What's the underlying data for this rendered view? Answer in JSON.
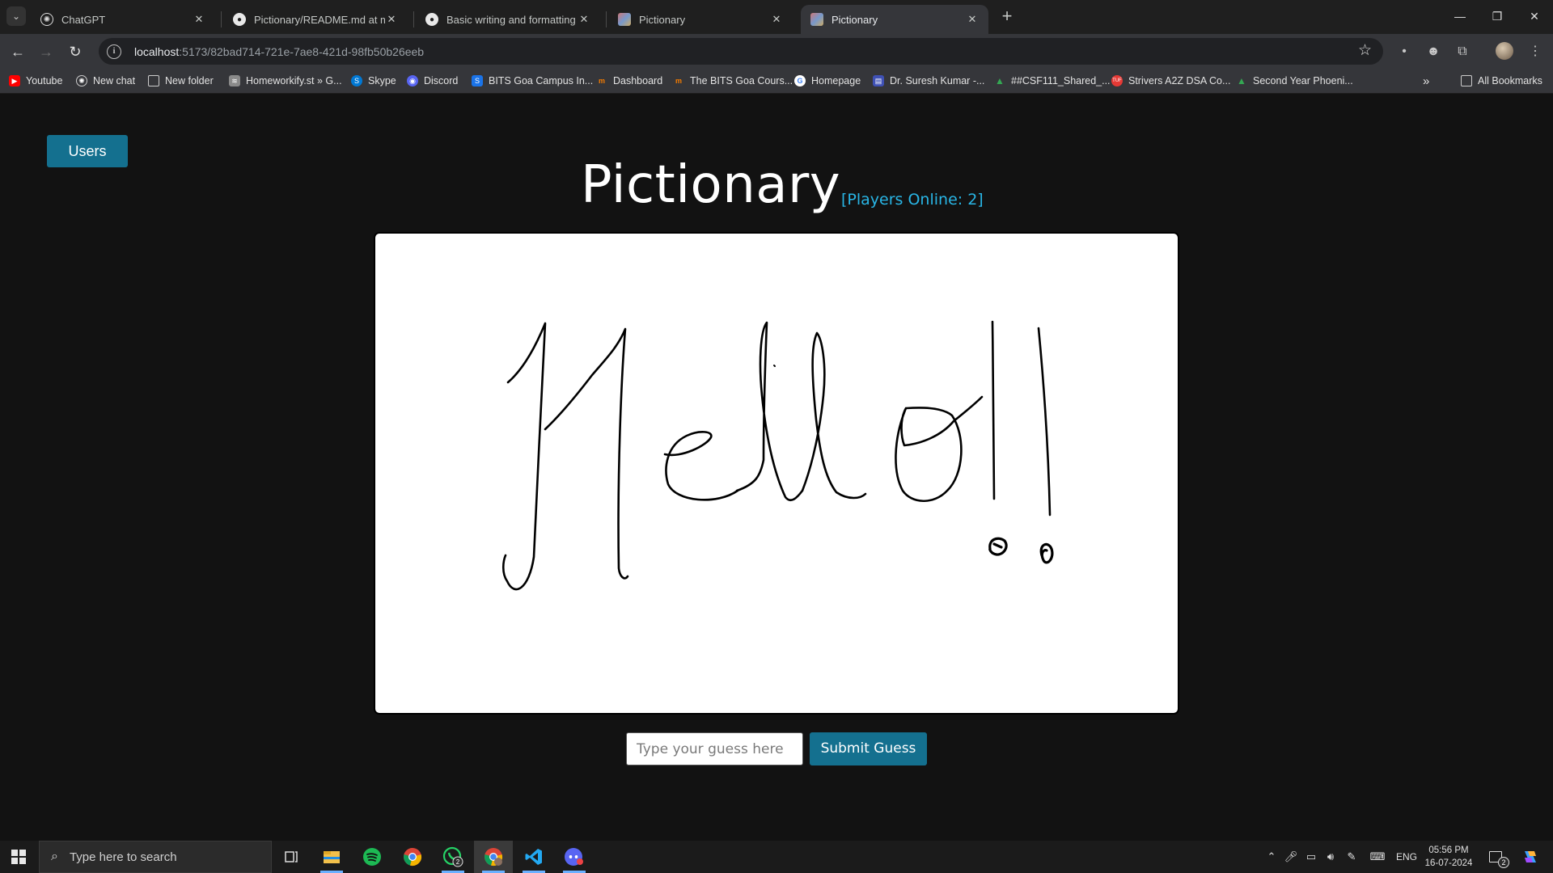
{
  "browser": {
    "tabs": [
      {
        "title": "ChatGPT",
        "icon": "chatgpt-icon"
      },
      {
        "title": "Pictionary/README.md at main",
        "icon": "github-icon"
      },
      {
        "title": "Basic writing and formatting sy",
        "icon": "github-docs-icon"
      },
      {
        "title": "Pictionary",
        "icon": "pictionary-favicon"
      },
      {
        "title": "Pictionary",
        "icon": "pictionary-favicon"
      }
    ],
    "active_tab": 4,
    "url_host": "localhost",
    "url_path": ":5173/82bad714-721e-7ae8-421d-98fb50b26eeb",
    "bookmarks": [
      {
        "label": "Youtube",
        "color": "#ff0000"
      },
      {
        "label": "New chat",
        "color": "#7a7a7a"
      },
      {
        "label": "New folder",
        "color": "#35363a"
      },
      {
        "label": "Homeworkify.st » G...",
        "color": "#8a8a8a"
      },
      {
        "label": "Skype",
        "color": "#0078d4"
      },
      {
        "label": "Discord",
        "color": "#5865f2"
      },
      {
        "label": "BITS Goa Campus In...",
        "color": "#1a73e8"
      },
      {
        "label": "Dashboard",
        "color": "#f57c00"
      },
      {
        "label": "The BITS Goa Cours...",
        "color": "#f57c00"
      },
      {
        "label": "Homepage",
        "color": "#ffffff"
      },
      {
        "label": "Dr. Suresh Kumar -...",
        "color": "#3f51b5"
      },
      {
        "label": "##CSF111_Shared_...",
        "color": "#34a853"
      },
      {
        "label": "Strivers A2Z DSA Co...",
        "color": "#e53935"
      },
      {
        "label": "Second Year Phoeni...",
        "color": "#34a853"
      }
    ],
    "all_bookmarks": "All Bookmarks"
  },
  "page": {
    "users_button": "Users",
    "title": "Pictionary",
    "players_online": "[Players Online: 2]",
    "guess_placeholder": "Type your guess here",
    "guess_value": "",
    "submit_button": "Submit Guess",
    "accent_color": "#14708f",
    "players_color": "#29b6e6"
  },
  "taskbar": {
    "search_placeholder": "Type here to search",
    "apps": [
      "task-view-icon",
      "file-explorer-icon",
      "spotify-icon",
      "chrome-icon",
      "whatsapp-icon",
      "chrome-profile-icon",
      "vscode-icon",
      "discord-icon"
    ],
    "whatsapp_badge": "2",
    "language": "ENG",
    "time": "05:56 PM",
    "date": "16-07-2024",
    "notification_count": "2"
  }
}
